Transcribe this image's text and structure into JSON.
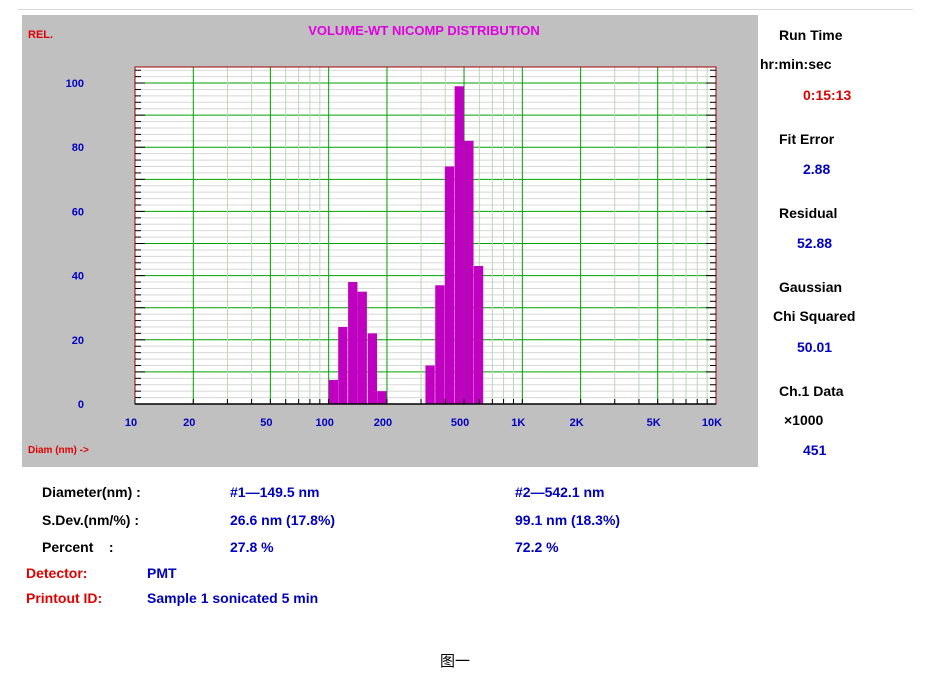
{
  "chart_data": {
    "type": "bar",
    "title": "VOLUME-WT NICOMP DISTRIBUTION",
    "ylabel": "REL.",
    "xlabel": "Diam (nm) ->",
    "x_scale": "log",
    "xlim": [
      10,
      10000
    ],
    "ylim": [
      0,
      105
    ],
    "x_tick_labels": [
      "10",
      "20",
      "50",
      "100",
      "200",
      "500",
      "1K",
      "2K",
      "5K",
      "10K"
    ],
    "x_tick_values": [
      10,
      20,
      50,
      100,
      200,
      500,
      1000,
      2000,
      5000,
      10000
    ],
    "y_tick_values": [
      0,
      20,
      40,
      60,
      80,
      100
    ],
    "grid": true,
    "bar_color": "#c000c0",
    "bars": [
      {
        "x": 100,
        "y": 7.5
      },
      {
        "x": 112,
        "y": 24
      },
      {
        "x": 126,
        "y": 38
      },
      {
        "x": 141,
        "y": 35
      },
      {
        "x": 159,
        "y": 22
      },
      {
        "x": 178,
        "y": 4
      },
      {
        "x": 316,
        "y": 12
      },
      {
        "x": 355,
        "y": 37
      },
      {
        "x": 398,
        "y": 74
      },
      {
        "x": 447,
        "y": 99
      },
      {
        "x": 501,
        "y": 82
      },
      {
        "x": 562,
        "y": 43
      }
    ]
  },
  "sidebar": {
    "run_time_label": "Run Time",
    "run_time_units": "hr:min:sec",
    "run_time_value": "0:15:13",
    "fit_error_label": "Fit Error",
    "fit_error_value": "2.88",
    "residual_label": "Residual",
    "residual_value": "52.88",
    "gaussian_label": "Gaussian",
    "chi_squared_label": "Chi Squared",
    "chi_squared_value": "50.01",
    "ch1_label": "Ch.1 Data",
    "ch1_scale": "×1000",
    "ch1_value": "451"
  },
  "results": {
    "diameter_label": "Diameter(nm) :",
    "peak1_diameter": "#1—149.5 nm",
    "peak2_diameter": "#2—542.1 nm",
    "sdev_label": "S.Dev.(nm/%) :",
    "peak1_sdev": "26.6 nm (17.8%)",
    "peak2_sdev": "99.1 nm (18.3%)",
    "percent_label": "Percent    :",
    "peak1_percent": "27.8 %",
    "peak2_percent": "72.2 %",
    "detector_label": "Detector:",
    "detector_value": "PMT",
    "printout_label": "Printout ID:",
    "printout_value": "Sample 1 sonicated 5 min"
  },
  "caption": "图一"
}
